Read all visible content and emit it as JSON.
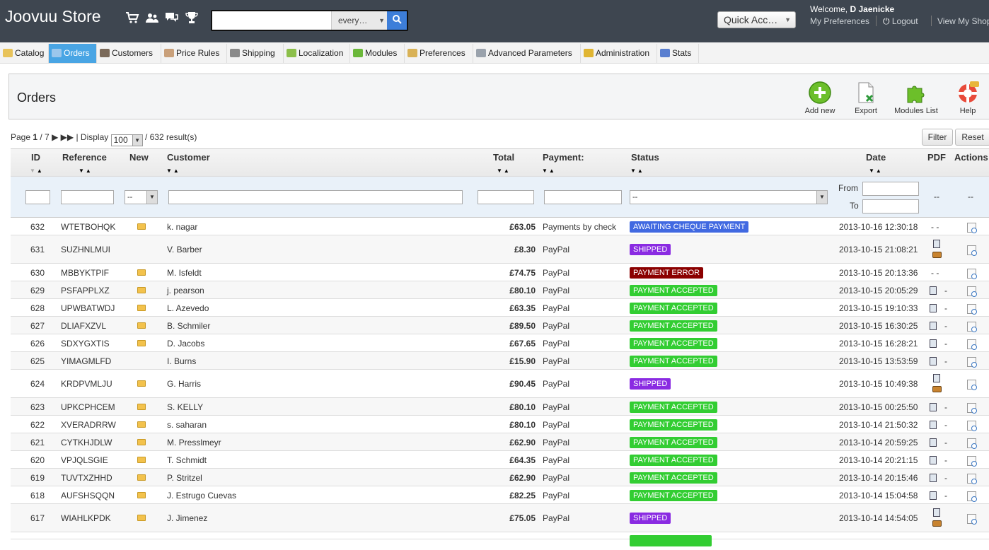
{
  "app": {
    "title": "Joovuu Store",
    "search_placeholder": "",
    "search_scope": "every…",
    "quick_access": "Quick Acc…",
    "welcome_prefix": "Welcome, ",
    "welcome_user": "D Jaenicke",
    "my_preferences": "My Preferences",
    "logout": "Logout",
    "view_shop": "View My Shop"
  },
  "tabs": [
    {
      "label": "Catalog",
      "icon": "folder-icon",
      "color": "#e8c35a"
    },
    {
      "label": "Orders",
      "icon": "cart-icon",
      "color": "#9cc7ec",
      "active": true
    },
    {
      "label": "Customers",
      "icon": "user-icon",
      "color": "#7b6a5a"
    },
    {
      "label": "Price Rules",
      "icon": "price-rules-icon",
      "color": "#c9a07a"
    },
    {
      "label": "Shipping",
      "icon": "truck-icon",
      "color": "#8a8a8a"
    },
    {
      "label": "Localization",
      "icon": "globe-icon",
      "color": "#8cbf4a"
    },
    {
      "label": "Modules",
      "icon": "puzzle-icon",
      "color": "#6bb83a"
    },
    {
      "label": "Preferences",
      "icon": "preferences-icon",
      "color": "#d9b256"
    },
    {
      "label": "Advanced Parameters",
      "icon": "wrench-icon",
      "color": "#9aa2ac"
    },
    {
      "label": "Administration",
      "icon": "key-icon",
      "color": "#e0b532"
    },
    {
      "label": "Stats",
      "icon": "bar-chart-icon",
      "color": "#5a7fd0"
    }
  ],
  "header": {
    "title": "Orders",
    "toolbar": {
      "add_new": "Add new",
      "export": "Export",
      "modules_list": "Modules List",
      "help": "Help"
    }
  },
  "pagination": {
    "page_label": "Page ",
    "current": "1",
    "total": " / 7",
    "display_label": "| Display",
    "per_page": "100",
    "results": "/ 632 result(s)",
    "filter_button": "Filter",
    "reset_button": "Reset"
  },
  "columns": {
    "id": "ID",
    "reference": "Reference",
    "new": "New",
    "customer": "Customer",
    "total": "Total",
    "payment": "Payment:",
    "status": "Status",
    "date": "Date",
    "pdf": "PDF",
    "actions": "Actions"
  },
  "filters": {
    "new_select": "--",
    "status_select": "--",
    "from_label": "From",
    "to_label": "To",
    "pdf_placeholder": "--",
    "actions_placeholder": "--"
  },
  "status_colors": {
    "AWAITING CHEQUE PAYMENT": "#4169e1",
    "SHIPPED": "#8a2be2",
    "PAYMENT ERROR": "#8b0000",
    "PAYMENT ACCEPTED": "#32cd32"
  },
  "orders": [
    {
      "id": "632",
      "reference": "WTETBOHQK",
      "new": true,
      "customer": "k. nagar",
      "total": "£63.05",
      "payment": "Payments by check",
      "status": "AWAITING CHEQUE PAYMENT",
      "date": "2013-10-16 12:30:18",
      "pdf": "- -"
    },
    {
      "id": "631",
      "reference": "SUZHNLMUI",
      "new": false,
      "customer": "V. Barber",
      "total": "£8.30",
      "payment": "PayPal",
      "status": "SHIPPED",
      "date": "2013-10-15 21:08:21",
      "pdf": "invoice+delivery"
    },
    {
      "id": "630",
      "reference": "MBBYKTPIF",
      "new": true,
      "customer": "M. Isfeldt",
      "total": "£74.75",
      "payment": "PayPal",
      "status": "PAYMENT ERROR",
      "date": "2013-10-15 20:13:36",
      "pdf": "- -"
    },
    {
      "id": "629",
      "reference": "PSFAPPLXZ",
      "new": true,
      "customer": "j. pearson",
      "total": "£80.10",
      "payment": "PayPal",
      "status": "PAYMENT ACCEPTED",
      "date": "2013-10-15 20:05:29",
      "pdf": "invoice"
    },
    {
      "id": "628",
      "reference": "UPWBATWDJ",
      "new": true,
      "customer": "L. Azevedo",
      "total": "£63.35",
      "payment": "PayPal",
      "status": "PAYMENT ACCEPTED",
      "date": "2013-10-15 19:10:33",
      "pdf": "invoice"
    },
    {
      "id": "627",
      "reference": "DLIAFXZVL",
      "new": true,
      "customer": "B. Schmiler",
      "total": "£89.50",
      "payment": "PayPal",
      "status": "PAYMENT ACCEPTED",
      "date": "2013-10-15 16:30:25",
      "pdf": "invoice"
    },
    {
      "id": "626",
      "reference": "SDXYGXTIS",
      "new": true,
      "customer": "D. Jacobs",
      "total": "£67.65",
      "payment": "PayPal",
      "status": "PAYMENT ACCEPTED",
      "date": "2013-10-15 16:28:21",
      "pdf": "invoice"
    },
    {
      "id": "625",
      "reference": "YIMAGMLFD",
      "new": false,
      "customer": "I. Burns",
      "total": "£15.90",
      "payment": "PayPal",
      "status": "PAYMENT ACCEPTED",
      "date": "2013-10-15 13:53:59",
      "pdf": "invoice"
    },
    {
      "id": "624",
      "reference": "KRDPVMLJU",
      "new": true,
      "customer": "G. Harris",
      "total": "£90.45",
      "payment": "PayPal",
      "status": "SHIPPED",
      "date": "2013-10-15 10:49:38",
      "pdf": "invoice+delivery"
    },
    {
      "id": "623",
      "reference": "UPKCPHCEM",
      "new": true,
      "customer": "S. KELLY",
      "total": "£80.10",
      "payment": "PayPal",
      "status": "PAYMENT ACCEPTED",
      "date": "2013-10-15 00:25:50",
      "pdf": "invoice"
    },
    {
      "id": "622",
      "reference": "XVERADRRW",
      "new": true,
      "customer": "s. saharan",
      "total": "£80.10",
      "payment": "PayPal",
      "status": "PAYMENT ACCEPTED",
      "date": "2013-10-14 21:50:32",
      "pdf": "invoice"
    },
    {
      "id": "621",
      "reference": "CYTKHJDLW",
      "new": true,
      "customer": "M. Presslmeyr",
      "total": "£62.90",
      "payment": "PayPal",
      "status": "PAYMENT ACCEPTED",
      "date": "2013-10-14 20:59:25",
      "pdf": "invoice"
    },
    {
      "id": "620",
      "reference": "VPJQLSGIE",
      "new": true,
      "customer": "T. Schmidt",
      "total": "£64.35",
      "payment": "PayPal",
      "status": "PAYMENT ACCEPTED",
      "date": "2013-10-14 20:21:15",
      "pdf": "invoice"
    },
    {
      "id": "619",
      "reference": "TUVTXZHHD",
      "new": true,
      "customer": "P. Stritzel",
      "total": "£62.90",
      "payment": "PayPal",
      "status": "PAYMENT ACCEPTED",
      "date": "2013-10-14 20:15:46",
      "pdf": "invoice"
    },
    {
      "id": "618",
      "reference": "AUFSHSQQN",
      "new": true,
      "customer": "J. Estrugo Cuevas",
      "total": "£82.25",
      "payment": "PayPal",
      "status": "PAYMENT ACCEPTED",
      "date": "2013-10-14 15:04:58",
      "pdf": "invoice"
    },
    {
      "id": "617",
      "reference": "WIAHLKPDK",
      "new": true,
      "customer": "J. Jimenez",
      "total": "£75.05",
      "payment": "PayPal",
      "status": "SHIPPED",
      "date": "2013-10-14 14:54:05",
      "pdf": "invoice+delivery"
    }
  ]
}
